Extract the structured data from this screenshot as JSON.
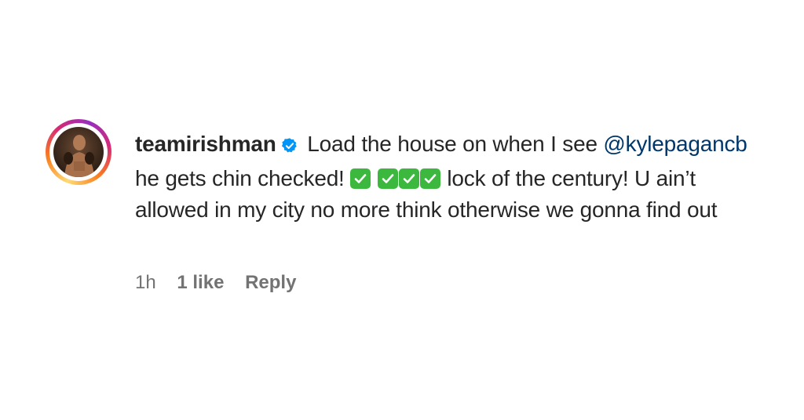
{
  "comment": {
    "username": "teamirishman",
    "text_part1": " Load the house on when I see ",
    "mention": "@kylepagancb",
    "text_part2": " he gets chin checked! ",
    "text_part3": " lock of the century! U ain’t allowed in my city no more think otherwise we gonna find out",
    "icons": [
      "verified-badge-icon",
      "check-mark-emoji"
    ],
    "time": "1h",
    "likes": "1 like",
    "reply_label": "Reply"
  },
  "colors": {
    "mention": "#00376b",
    "verified": "#0095f6",
    "meta": "#737373",
    "check_bg": "#3db83f"
  }
}
